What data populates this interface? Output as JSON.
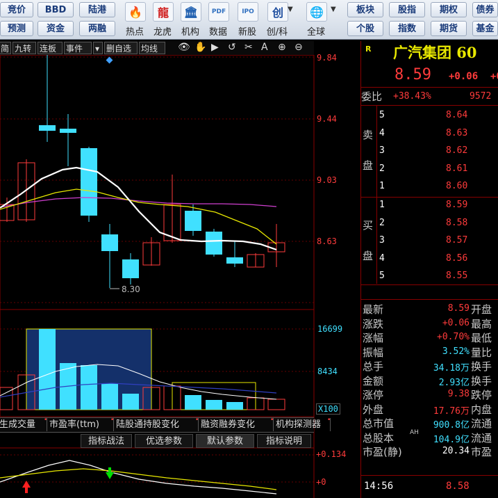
{
  "toolbar": {
    "left_buttons": [
      {
        "top": "竞价",
        "bottom": "预测"
      },
      {
        "top": "BBD",
        "bottom": "资金"
      },
      {
        "top": "陆港",
        "bottom": "两融"
      }
    ],
    "icon_items": [
      {
        "icon": "fire-icon",
        "glyph": "🔥",
        "label": "热点"
      },
      {
        "icon": "dragon-icon",
        "glyph": "龍",
        "label": "龙虎"
      },
      {
        "icon": "institution-icon",
        "glyph": "🏛",
        "label": "机构"
      },
      {
        "icon": "pdf-icon",
        "glyph": "PDF",
        "label": "数据"
      },
      {
        "icon": "ipo-icon",
        "glyph": "IPO",
        "label": "新股"
      },
      {
        "icon": "chuang-icon",
        "glyph": "创",
        "label": "创/科"
      },
      {
        "icon": "globe-icon",
        "glyph": "🌐",
        "label": "全球"
      }
    ],
    "right_buttons": [
      {
        "top": "板块",
        "bottom": "个股"
      },
      {
        "top": "股指",
        "bottom": "指数"
      },
      {
        "top": "期权",
        "bottom": "期货"
      },
      {
        "top": "债券",
        "bottom": "基金"
      }
    ]
  },
  "chart_toolbar": {
    "tabs": [
      "简",
      "九转",
      "连板",
      "事件"
    ],
    "dropdown": "▾",
    "tabs2": [
      "删自选",
      "均线"
    ],
    "icons": [
      {
        "name": "eye-icon",
        "glyph": "👁"
      },
      {
        "name": "hand-icon",
        "glyph": "✋"
      },
      {
        "name": "play-icon",
        "glyph": "▶"
      },
      {
        "name": "undo-icon",
        "glyph": "↺"
      },
      {
        "name": "scissors-icon",
        "glyph": "✂"
      },
      {
        "name": "text-tool-icon",
        "glyph": "A"
      },
      {
        "name": "zoom-in-icon",
        "glyph": "⊕"
      },
      {
        "name": "zoom-out-icon",
        "glyph": "⊖"
      }
    ]
  },
  "price_axis": [
    "9.84",
    "9.44",
    "9.03",
    "8.63"
  ],
  "low_label": "8.30",
  "volume_axis": {
    "top": "16699",
    "mid": "8434",
    "unit": "X100"
  },
  "indicator_axis": {
    "top": "+0.134",
    "zero": "+0"
  },
  "indicator_tabs": [
    "生成交量",
    "市盈率(ttm)",
    "陆股通持股变化",
    "融资融券变化",
    "机构探测器"
  ],
  "sub_tabs": [
    "指标战法",
    "优选参数",
    "默认参数",
    "指标说明"
  ],
  "stock": {
    "badge": "R",
    "name": "广汽集团 60",
    "price": "8.59",
    "change": "+0.06",
    "change_tail": "+0",
    "weibi_label": "委比",
    "weibi_value": "+38.43%",
    "weibi_diff": "9572"
  },
  "sell_side": {
    "label_top": "卖",
    "label_bottom": "盘",
    "levels": [
      {
        "n": "5",
        "p": "8.64"
      },
      {
        "n": "4",
        "p": "8.63"
      },
      {
        "n": "3",
        "p": "8.62"
      },
      {
        "n": "2",
        "p": "8.61"
      },
      {
        "n": "1",
        "p": "8.60"
      }
    ]
  },
  "buy_side": {
    "label_top": "买",
    "label_bottom": "盘",
    "levels": [
      {
        "n": "1",
        "p": "8.59"
      },
      {
        "n": "2",
        "p": "8.58"
      },
      {
        "n": "3",
        "p": "8.57"
      },
      {
        "n": "4",
        "p": "8.56"
      },
      {
        "n": "5",
        "p": "8.55"
      }
    ]
  },
  "stats": [
    {
      "label": "最新",
      "value": "8.59",
      "cls": "red",
      "r": "开盘"
    },
    {
      "label": "涨跌",
      "value": "+0.06",
      "cls": "red",
      "r": "最高"
    },
    {
      "label": "涨幅",
      "value": "+0.70%",
      "cls": "red",
      "r": "最低"
    },
    {
      "label": "振幅",
      "value": "3.52%",
      "cls": "cyan",
      "r": "量比"
    },
    {
      "label": "总手",
      "value": "34.18万",
      "cls": "cyan",
      "r": "换手"
    },
    {
      "label": "金额",
      "value": "2.93亿",
      "cls": "cyan",
      "r": "换手"
    },
    {
      "label": "涨停",
      "value": "9.38",
      "cls": "red",
      "r": "跌停"
    },
    {
      "label": "外盘",
      "value": "17.76万",
      "cls": "red",
      "r": "内盘"
    },
    {
      "label": "总市值",
      "value": "900.8亿",
      "cls": "cyan",
      "r": "流通"
    },
    {
      "label": "总股本",
      "value": "104.9亿",
      "cls": "cyan",
      "r": "流通",
      "badge": "AH"
    },
    {
      "label": "市盈(静)",
      "value": "20.34",
      "cls": "white",
      "r": "市盈"
    }
  ],
  "tick": {
    "time": "14:56",
    "price": "8.58"
  },
  "colors": {
    "up": "#ff3b3b",
    "down": "#40e0ff",
    "ma_white": "#ffffff",
    "ma_yellow": "#e8e800",
    "ma_purple": "#d040d0"
  }
}
